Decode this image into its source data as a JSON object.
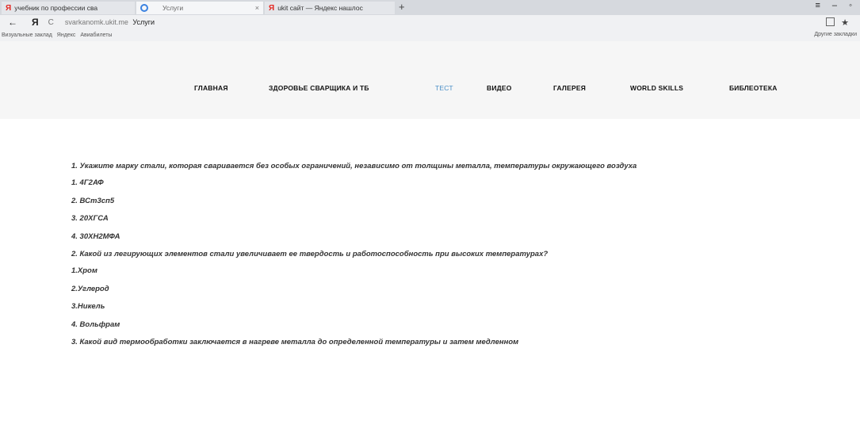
{
  "browser": {
    "tabs": [
      {
        "label": "учебник по профессии сва",
        "icon": "yandex-icon"
      },
      {
        "label": "Услуги",
        "icon": "loading-icon",
        "close": "×"
      },
      {
        "label": "ukit сайт — Яндекс нашлос",
        "icon": "yandex-icon"
      }
    ],
    "new_tab_label": "+",
    "window_controls": "≡ – ◦",
    "address": {
      "back": "←",
      "logo": "Я",
      "reload": "C",
      "host": "svarkanomk.ukit.me",
      "page_title": "Услуги"
    },
    "bookmarks": {
      "items": [
        "Визуальные заклад",
        "Яндекс",
        "Авиабилеты"
      ],
      "other": "Другие закладки"
    }
  },
  "site_nav": {
    "items": [
      "ГЛАВНАЯ",
      "ЗДОРОВЬЕ СВАРЩИКА И ТБ",
      "ТЕСТ",
      "ВИДЕО",
      "ГАЛЕРЕЯ",
      "WORLD SKILLS",
      "БИБЛЕОТЕКА"
    ],
    "active": "ТЕСТ",
    "active_color": "#4a8fc7"
  },
  "quiz": [
    {
      "question": "1. Укажите марку стали, которая сваривается без особых ограничений, независимо от толщины металла, температуры окружающего воздуха",
      "options": [
        "1. 4Г2АФ",
        "2. ВСт3сп5",
        "3. 20ХГСА",
        "4. 30ХН2МФА"
      ]
    },
    {
      "question": "2. Какой из легирующих элементов стали увеличивает ее твердость и работоспособность при высоких температурах?",
      "options": [
        "1.Хром",
        "2.Углерод",
        "3.Никель",
        "4. Вольфрам"
      ]
    },
    {
      "question": "3. Какой вид термообработки заключается в нагреве металла до определенной температуры и затем медленном",
      "options": []
    }
  ]
}
